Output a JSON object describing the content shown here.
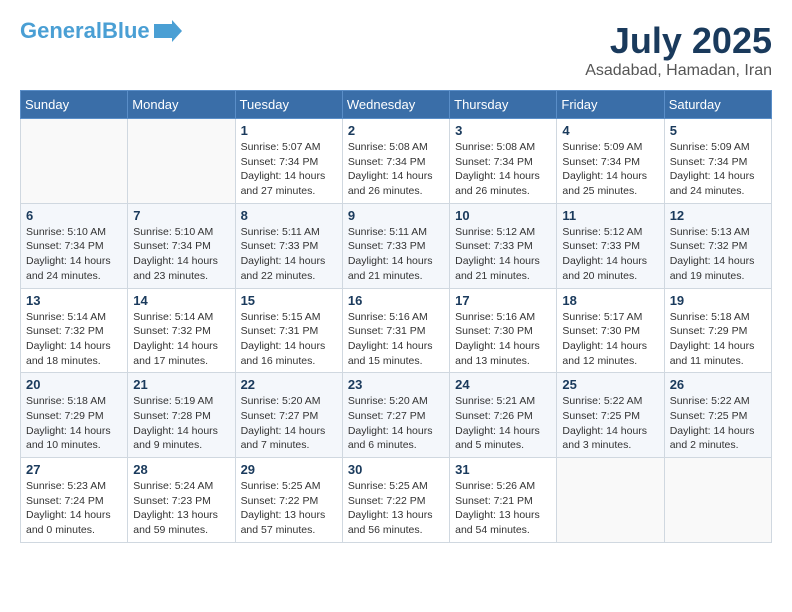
{
  "header": {
    "logo_general": "General",
    "logo_blue": "Blue",
    "month_title": "July 2025",
    "location": "Asadabad, Hamadan, Iran"
  },
  "weekdays": [
    "Sunday",
    "Monday",
    "Tuesday",
    "Wednesday",
    "Thursday",
    "Friday",
    "Saturday"
  ],
  "weeks": [
    [
      {
        "day": "",
        "info": ""
      },
      {
        "day": "",
        "info": ""
      },
      {
        "day": "1",
        "sunrise": "Sunrise: 5:07 AM",
        "sunset": "Sunset: 7:34 PM",
        "daylight": "Daylight: 14 hours and 27 minutes."
      },
      {
        "day": "2",
        "sunrise": "Sunrise: 5:08 AM",
        "sunset": "Sunset: 7:34 PM",
        "daylight": "Daylight: 14 hours and 26 minutes."
      },
      {
        "day": "3",
        "sunrise": "Sunrise: 5:08 AM",
        "sunset": "Sunset: 7:34 PM",
        "daylight": "Daylight: 14 hours and 26 minutes."
      },
      {
        "day": "4",
        "sunrise": "Sunrise: 5:09 AM",
        "sunset": "Sunset: 7:34 PM",
        "daylight": "Daylight: 14 hours and 25 minutes."
      },
      {
        "day": "5",
        "sunrise": "Sunrise: 5:09 AM",
        "sunset": "Sunset: 7:34 PM",
        "daylight": "Daylight: 14 hours and 24 minutes."
      }
    ],
    [
      {
        "day": "6",
        "sunrise": "Sunrise: 5:10 AM",
        "sunset": "Sunset: 7:34 PM",
        "daylight": "Daylight: 14 hours and 24 minutes."
      },
      {
        "day": "7",
        "sunrise": "Sunrise: 5:10 AM",
        "sunset": "Sunset: 7:34 PM",
        "daylight": "Daylight: 14 hours and 23 minutes."
      },
      {
        "day": "8",
        "sunrise": "Sunrise: 5:11 AM",
        "sunset": "Sunset: 7:33 PM",
        "daylight": "Daylight: 14 hours and 22 minutes."
      },
      {
        "day": "9",
        "sunrise": "Sunrise: 5:11 AM",
        "sunset": "Sunset: 7:33 PM",
        "daylight": "Daylight: 14 hours and 21 minutes."
      },
      {
        "day": "10",
        "sunrise": "Sunrise: 5:12 AM",
        "sunset": "Sunset: 7:33 PM",
        "daylight": "Daylight: 14 hours and 21 minutes."
      },
      {
        "day": "11",
        "sunrise": "Sunrise: 5:12 AM",
        "sunset": "Sunset: 7:33 PM",
        "daylight": "Daylight: 14 hours and 20 minutes."
      },
      {
        "day": "12",
        "sunrise": "Sunrise: 5:13 AM",
        "sunset": "Sunset: 7:32 PM",
        "daylight": "Daylight: 14 hours and 19 minutes."
      }
    ],
    [
      {
        "day": "13",
        "sunrise": "Sunrise: 5:14 AM",
        "sunset": "Sunset: 7:32 PM",
        "daylight": "Daylight: 14 hours and 18 minutes."
      },
      {
        "day": "14",
        "sunrise": "Sunrise: 5:14 AM",
        "sunset": "Sunset: 7:32 PM",
        "daylight": "Daylight: 14 hours and 17 minutes."
      },
      {
        "day": "15",
        "sunrise": "Sunrise: 5:15 AM",
        "sunset": "Sunset: 7:31 PM",
        "daylight": "Daylight: 14 hours and 16 minutes."
      },
      {
        "day": "16",
        "sunrise": "Sunrise: 5:16 AM",
        "sunset": "Sunset: 7:31 PM",
        "daylight": "Daylight: 14 hours and 15 minutes."
      },
      {
        "day": "17",
        "sunrise": "Sunrise: 5:16 AM",
        "sunset": "Sunset: 7:30 PM",
        "daylight": "Daylight: 14 hours and 13 minutes."
      },
      {
        "day": "18",
        "sunrise": "Sunrise: 5:17 AM",
        "sunset": "Sunset: 7:30 PM",
        "daylight": "Daylight: 14 hours and 12 minutes."
      },
      {
        "day": "19",
        "sunrise": "Sunrise: 5:18 AM",
        "sunset": "Sunset: 7:29 PM",
        "daylight": "Daylight: 14 hours and 11 minutes."
      }
    ],
    [
      {
        "day": "20",
        "sunrise": "Sunrise: 5:18 AM",
        "sunset": "Sunset: 7:29 PM",
        "daylight": "Daylight: 14 hours and 10 minutes."
      },
      {
        "day": "21",
        "sunrise": "Sunrise: 5:19 AM",
        "sunset": "Sunset: 7:28 PM",
        "daylight": "Daylight: 14 hours and 9 minutes."
      },
      {
        "day": "22",
        "sunrise": "Sunrise: 5:20 AM",
        "sunset": "Sunset: 7:27 PM",
        "daylight": "Daylight: 14 hours and 7 minutes."
      },
      {
        "day": "23",
        "sunrise": "Sunrise: 5:20 AM",
        "sunset": "Sunset: 7:27 PM",
        "daylight": "Daylight: 14 hours and 6 minutes."
      },
      {
        "day": "24",
        "sunrise": "Sunrise: 5:21 AM",
        "sunset": "Sunset: 7:26 PM",
        "daylight": "Daylight: 14 hours and 5 minutes."
      },
      {
        "day": "25",
        "sunrise": "Sunrise: 5:22 AM",
        "sunset": "Sunset: 7:25 PM",
        "daylight": "Daylight: 14 hours and 3 minutes."
      },
      {
        "day": "26",
        "sunrise": "Sunrise: 5:22 AM",
        "sunset": "Sunset: 7:25 PM",
        "daylight": "Daylight: 14 hours and 2 minutes."
      }
    ],
    [
      {
        "day": "27",
        "sunrise": "Sunrise: 5:23 AM",
        "sunset": "Sunset: 7:24 PM",
        "daylight": "Daylight: 14 hours and 0 minutes."
      },
      {
        "day": "28",
        "sunrise": "Sunrise: 5:24 AM",
        "sunset": "Sunset: 7:23 PM",
        "daylight": "Daylight: 13 hours and 59 minutes."
      },
      {
        "day": "29",
        "sunrise": "Sunrise: 5:25 AM",
        "sunset": "Sunset: 7:22 PM",
        "daylight": "Daylight: 13 hours and 57 minutes."
      },
      {
        "day": "30",
        "sunrise": "Sunrise: 5:25 AM",
        "sunset": "Sunset: 7:22 PM",
        "daylight": "Daylight: 13 hours and 56 minutes."
      },
      {
        "day": "31",
        "sunrise": "Sunrise: 5:26 AM",
        "sunset": "Sunset: 7:21 PM",
        "daylight": "Daylight: 13 hours and 54 minutes."
      },
      {
        "day": "",
        "info": ""
      },
      {
        "day": "",
        "info": ""
      }
    ]
  ]
}
